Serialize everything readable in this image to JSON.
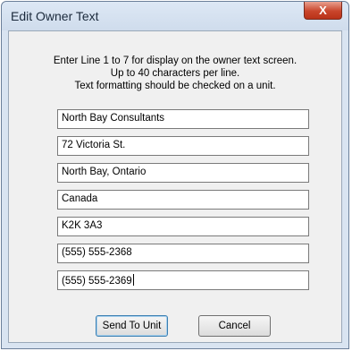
{
  "window": {
    "title": "Edit Owner Text",
    "close_label": "X"
  },
  "instructions": [
    "Enter Line 1 to 7 for display on the owner text screen.",
    "Up to 40 characters per line.",
    "Text formatting should be checked on a unit."
  ],
  "lines": [
    "North Bay Consultants",
    "72 Victoria St.",
    "North Bay, Ontario",
    "Canada",
    "K2K 3A3",
    "(555) 555-2368",
    "(555) 555-2369"
  ],
  "buttons": {
    "send": "Send To Unit",
    "cancel": "Cancel"
  }
}
